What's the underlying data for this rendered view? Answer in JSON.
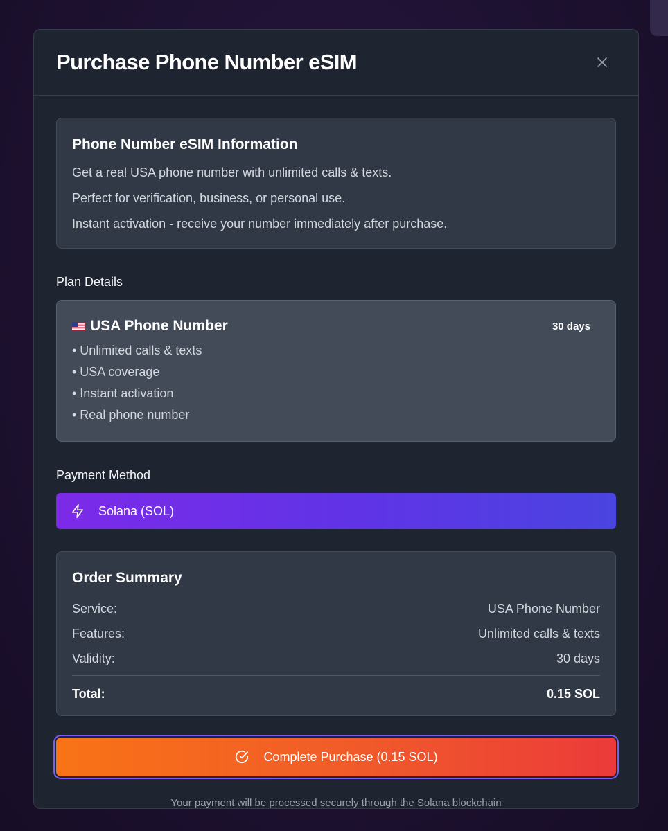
{
  "dialog": {
    "title": "Purchase Phone Number eSIM",
    "close_icon": "close-icon"
  },
  "info": {
    "heading": "Phone Number eSIM Information",
    "lines": [
      "Get a real USA phone number with unlimited calls & texts.",
      "Perfect for verification, business, or personal use.",
      "Instant activation - receive your number immediately after purchase."
    ]
  },
  "plan": {
    "section_label": "Plan Details",
    "flag_icon": "us-flag-icon",
    "name": "USA Phone Number",
    "duration": "30 days",
    "features": [
      "• Unlimited calls & texts",
      "• USA coverage",
      "• Instant activation",
      "• Real phone number"
    ]
  },
  "payment": {
    "section_label": "Payment Method",
    "icon": "lightning-icon",
    "method": "Solana (SOL)"
  },
  "summary": {
    "heading": "Order Summary",
    "rows": [
      {
        "label": "Service:",
        "value": "USA Phone Number"
      },
      {
        "label": "Features:",
        "value": "Unlimited calls & texts"
      },
      {
        "label": "Validity:",
        "value": "30 days"
      }
    ],
    "total_label": "Total:",
    "total_value": "0.15 SOL"
  },
  "purchase_button": {
    "icon": "check-circle-icon",
    "label": "Complete Purchase (0.15 SOL)"
  },
  "footnote": "Your payment will be processed securely through the Solana blockchain",
  "colors": {
    "modal_bg": "#1e2430",
    "card_bg": "#313846",
    "payment_gradient_start": "#7c2ae8",
    "payment_gradient_end": "#4a44e0",
    "purchase_gradient_start": "#f97316",
    "purchase_gradient_end": "#ec3a3a",
    "focus_ring": "#7c5cf0"
  }
}
